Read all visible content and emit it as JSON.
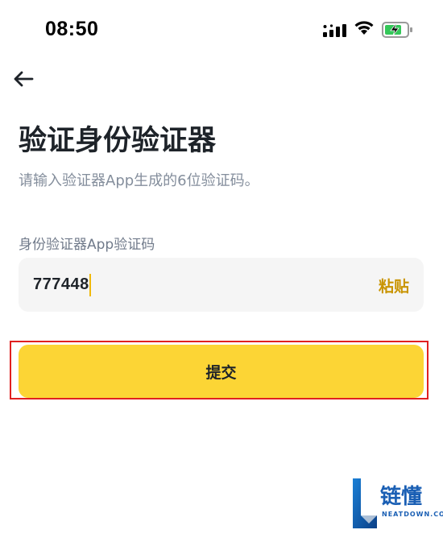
{
  "status_bar": {
    "time": "08:50",
    "icons": [
      "cellular-signal-icon",
      "wifi-icon",
      "battery-charging-icon"
    ],
    "battery_color": "#34c759"
  },
  "nav": {
    "back_icon": "arrow-left-icon"
  },
  "page": {
    "title": "验证身份验证器",
    "subtitle": "请输入验证器App生成的6位验证码。"
  },
  "form": {
    "field_label": "身份验证器App验证码",
    "code_value": "777448",
    "paste_label": "粘贴",
    "submit_label": "提交"
  },
  "colors": {
    "accent": "#fcd535",
    "paste": "#c99400",
    "highlight": "#e02020",
    "caret": "#f0b90b"
  },
  "watermark": {
    "brand": "链懂",
    "site": "NEATDOWN.COM"
  }
}
